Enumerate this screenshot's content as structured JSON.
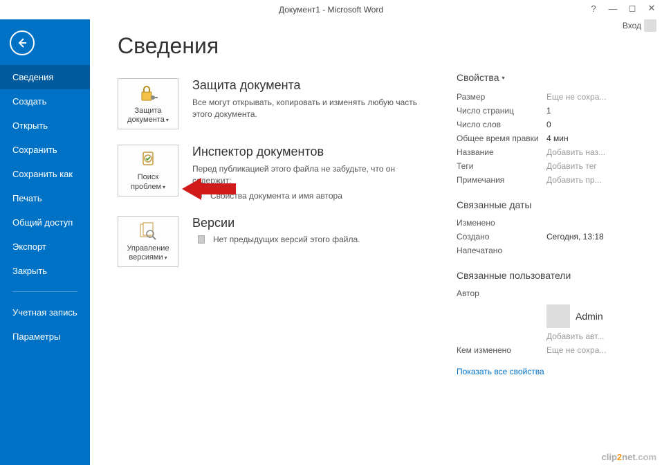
{
  "titlebar": {
    "title": "Документ1 - Microsoft Word",
    "signin": "Вход"
  },
  "sidebar": {
    "items": [
      {
        "label": "Сведения",
        "active": true
      },
      {
        "label": "Создать"
      },
      {
        "label": "Открыть"
      },
      {
        "label": "Сохранить"
      },
      {
        "label": "Сохранить как"
      },
      {
        "label": "Печать"
      },
      {
        "label": "Общий доступ"
      },
      {
        "label": "Экспорт"
      },
      {
        "label": "Закрыть"
      }
    ],
    "footer": [
      {
        "label": "Учетная запись"
      },
      {
        "label": "Параметры"
      }
    ]
  },
  "page": {
    "title": "Сведения"
  },
  "sections": {
    "protect": {
      "btn": "Защита документа",
      "heading": "Защита документа",
      "body": "Все могут открывать, копировать и изменять любую часть этого документа."
    },
    "inspect": {
      "btn": "Поиск проблем",
      "heading": "Инспектор документов",
      "body": "Перед публикацией этого файла не забудьте, что он содержит:",
      "bullet1": "Свойства документа и имя автора"
    },
    "versions": {
      "btn": "Управление версиями",
      "heading": "Версии",
      "bullet1": "Нет предыдущих версий этого файла."
    }
  },
  "props": {
    "header": "Свойства",
    "rows": {
      "size_k": "Размер",
      "size_v": "Еще не сохра...",
      "pages_k": "Число страниц",
      "pages_v": "1",
      "words_k": "Число слов",
      "words_v": "0",
      "time_k": "Общее время правки",
      "time_v": "4 мин",
      "title_k": "Название",
      "title_v": "Добавить наз...",
      "tags_k": "Теги",
      "tags_v": "Добавить тег",
      "notes_k": "Примечания",
      "notes_v": "Добавить пр..."
    },
    "dates": {
      "header": "Связанные даты",
      "modified_k": "Изменено",
      "modified_v": "",
      "created_k": "Создано",
      "created_v": "Сегодня, 13:18",
      "printed_k": "Напечатано",
      "printed_v": ""
    },
    "users": {
      "header": "Связанные пользователи",
      "author_k": "Автор",
      "author_name": "Admin",
      "add_author": "Добавить авт...",
      "lastmod_k": "Кем изменено",
      "lastmod_v": "Еще не сохра..."
    },
    "show_all": "Показать все свойства"
  },
  "watermark": {
    "pre": "clip",
    "mid": "2",
    "post": "net",
    "suf": ".com"
  }
}
